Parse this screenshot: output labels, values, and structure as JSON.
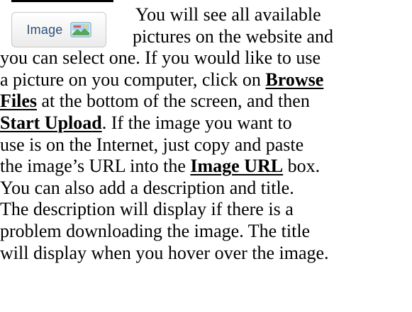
{
  "image_button": {
    "label": "Image",
    "icon": "picture-icon"
  },
  "paragraph": {
    "line1": "You will see all available",
    "line2": "pictures on the website and",
    "line3": "you can select one.  If you would like to use",
    "line4a": "a picture on you computer, click on ",
    "browse_part1": "Browse",
    "browse_part2": "Files",
    "line5b": " at the bottom of the screen, and then",
    "start_upload": "Start Upload",
    "line6b": ".   If the image you want to",
    "line7": "use is on the Internet, just copy and paste",
    "line8a": "the image’s URL into the ",
    "image_url": "Image URL",
    "line8b": " box.",
    "line9": "You can also add a description and title.",
    "line10": "The description will display if there is a",
    "line11": "problem downloading the image.  The title",
    "line12": "will display when you hover over the image."
  },
  "colors": {
    "button_text": "#2d5176",
    "button_border": "#c8c8c8"
  }
}
